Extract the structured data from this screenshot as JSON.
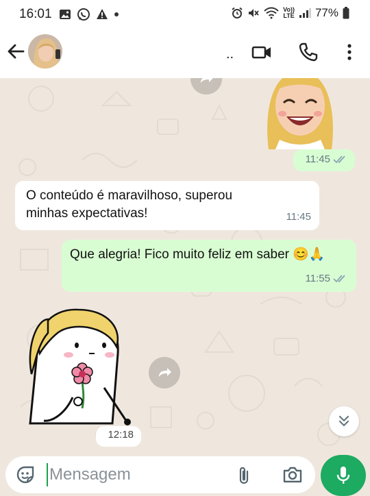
{
  "status_bar": {
    "time": "16:01",
    "lte_top": "Vo))",
    "lte_bottom": "LTE",
    "battery": "77%"
  },
  "header": {
    "contact_name": ".."
  },
  "messages": [
    {
      "text": "O conteúdo é maravilhoso, superou minhas expectativas!",
      "time": "11:45",
      "direction": "in"
    },
    {
      "text": "Que alegria! Fico muito feliz em saber 😊🙏",
      "time": "11:55",
      "direction": "out"
    }
  ],
  "stickers": [
    {
      "time": "11:45",
      "direction": "out"
    },
    {
      "time": "12:18",
      "direction": "in"
    }
  ],
  "input": {
    "placeholder": "Mensagem"
  },
  "colors": {
    "accent": "#1daa61",
    "outgoing_bubble": "#d9fdd3",
    "incoming_bubble": "#ffffff",
    "chat_background": "#efe7de",
    "read_ticks": "#53bdeb"
  }
}
